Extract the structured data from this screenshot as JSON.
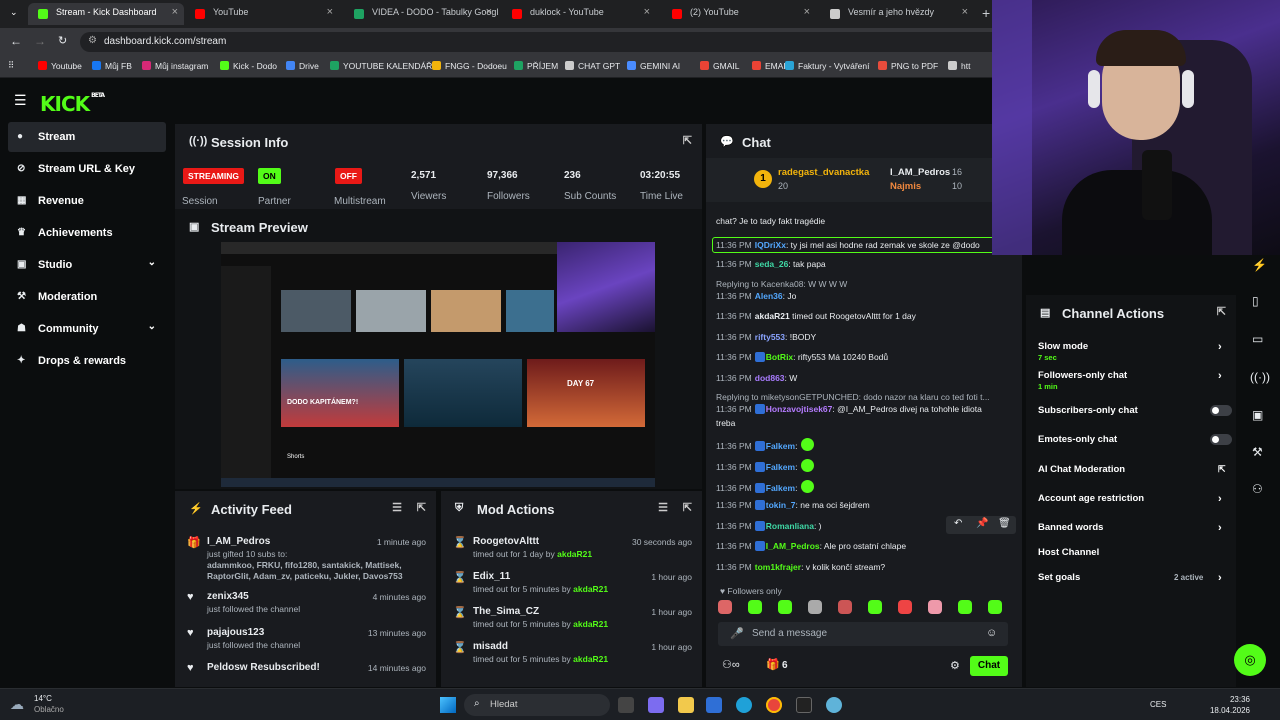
{
  "tabs": [
    {
      "title": "Stream - Kick Dashboard",
      "color": "#53fc18",
      "active": true
    },
    {
      "title": "YouTube",
      "color": "#ff0000"
    },
    {
      "title": "VIDEA - DODO - Tabulky Googl",
      "color": "#1ea362"
    },
    {
      "title": "duklock - YouTube",
      "color": "#ff0000"
    },
    {
      "title": "(2) YouTube",
      "color": "#ff0000"
    },
    {
      "title": "Vesmír a jeho hvězdy",
      "color": "#cccccc"
    }
  ],
  "url": "dashboard.kick.com/stream",
  "bookmarks": [
    "Youtube",
    "Můj FB",
    "Můj instagram",
    "Kick - Dodo",
    "Drive",
    "YOUTUBE KALENDÁŘ",
    "FNGG - Dodoeu",
    "PŘÍJEM",
    "CHAT GPT",
    "GEMINI AI",
    "GMAIL",
    "EMAIL",
    "Faktury - Vytváření",
    "PNG to PDF",
    "htt"
  ],
  "logo": "KICK",
  "logo_sup": "BETA",
  "nav": [
    {
      "label": "Stream",
      "icon": "●"
    },
    {
      "label": "Stream URL & Key",
      "icon": "⊘"
    },
    {
      "label": "Revenue",
      "icon": "▦"
    },
    {
      "label": "Achievements",
      "icon": "♛"
    },
    {
      "label": "Studio",
      "icon": "▣"
    },
    {
      "label": "Moderation",
      "icon": "⚒"
    },
    {
      "label": "Community",
      "icon": "☗"
    },
    {
      "label": "Drops & rewards",
      "icon": "✦"
    }
  ],
  "session": {
    "title": "Session Info",
    "status": "STREAMING",
    "status_label": "Session",
    "partner": "ON",
    "partner_label": "Partner",
    "multistream": "OFF",
    "multistream_label": "Multistream",
    "viewers": "2,571",
    "viewers_label": "Viewers",
    "followers": "97,366",
    "followers_label": "Followers",
    "subs": "236",
    "subs_label": "Sub Counts",
    "time": "03:20:55",
    "time_label": "Time Live"
  },
  "preview_title": "Stream Preview",
  "preview_text": {
    "t1": "DODO KAPITÁNEM?!",
    "t2": "DAY 67",
    "t3": "Shorts"
  },
  "activity": {
    "title": "Activity Feed",
    "items": [
      {
        "name": "I_AM_Pedros",
        "text": "just gifted 10 subs to:",
        "time": "1 minute ago",
        "list": "adammkoo, FRKU, fifo1280, santakick, Mattisek, RaptorGlit, Adam_zv, paticeku, Jukler, Davos753"
      },
      {
        "name": "zenix345",
        "text": "just followed the channel",
        "time": "4 minutes ago"
      },
      {
        "name": "pajajous123",
        "text": "just followed the channel",
        "time": "13 minutes ago"
      },
      {
        "name": "Peldosw Resubscribed!",
        "text": "",
        "time": "14 minutes ago"
      }
    ]
  },
  "mod": {
    "title": "Mod Actions",
    "items": [
      {
        "name": "RoogetovAlttt",
        "pre": "timed out for 1 day by",
        "by": "akdaR21",
        "time": "30 seconds ago"
      },
      {
        "name": "Edix_11",
        "pre": "timed out for 5 minutes by",
        "by": "akdaR21",
        "time": "1 hour ago"
      },
      {
        "name": "The_Sima_CZ",
        "pre": "timed out for 5 minutes by",
        "by": "akdaR21",
        "time": "1 hour ago"
      },
      {
        "name": "misadd",
        "pre": "timed out for 5 minutes by",
        "by": "akdaR21",
        "time": "1 hour ago"
      }
    ]
  },
  "chat": {
    "title": "Chat",
    "pinned": {
      "rank": "1",
      "u1": "radegast_dvanactka",
      "v1": "20",
      "u2": "I_AM_Pedros",
      "v2": "16",
      "u3": "Najmis",
      "v3": "10"
    },
    "messages": [
      {
        "time": "",
        "user": "",
        "color": "#e9ecef",
        "text": "chat? Je to tady fakt tragédie"
      },
      {
        "time": "11:36 PM",
        "user": "IQDriXx",
        "color": "#53a8ff",
        "text": ": ty jsi mel asi hodne rad zemak ve skole ze @dodo"
      },
      {
        "time": "11:36 PM",
        "user": "seda_26",
        "color": "#3fd9a6",
        "text": ": tak papa"
      },
      {
        "time": "",
        "user": "",
        "color": "#adb5bd",
        "text": "Replying to Kacenka08: W W W W"
      },
      {
        "time": "11:36 PM",
        "user": "Alen36",
        "color": "#53a8ff",
        "text": ": Jo"
      },
      {
        "time": "11:36 PM",
        "user": "akdaR21",
        "color": "#e9ecef",
        "text": " timed out RoogetovAlttt for 1 day"
      },
      {
        "time": "11:36 PM",
        "user": "rifty553",
        "color": "#8aa4ff",
        "text": ": !BODY"
      },
      {
        "time": "11:36 PM",
        "user": "BotRix",
        "color": "#53fc18",
        "text": ": rifty553 Má 10240 Bodů"
      },
      {
        "time": "11:36 PM",
        "user": "dod863",
        "color": "#a97cff",
        "text": ": W"
      },
      {
        "time": "",
        "user": "",
        "color": "#adb5bd",
        "text": "Replying to miketysonGETPUNCHED: dodo nazor na klaru co ted foti t..."
      },
      {
        "time": "11:36 PM",
        "user": "Honzavojtisek67",
        "color": "#b57cff",
        "text": ": @I_AM_Pedros divej na tohohle idiota"
      },
      {
        "time": "",
        "user": "",
        "color": "#e9ecef",
        "text": "treba"
      },
      {
        "time": "11:36 PM",
        "user": "Falkem",
        "color": "#53a8ff",
        "text": ":"
      },
      {
        "time": "11:36 PM",
        "user": "Falkem",
        "color": "#53a8ff",
        "text": ":"
      },
      {
        "time": "11:36 PM",
        "user": "Falkem",
        "color": "#53a8ff",
        "text": ":"
      },
      {
        "time": "11:36 PM",
        "user": "tokin_7",
        "color": "#53a8ff",
        "text": ": ne ma oci šejdrem"
      },
      {
        "time": "11:36 PM",
        "user": "Romanliana",
        "color": "#3fd9a6",
        "text": ": )"
      },
      {
        "time": "11:36 PM",
        "user": "I_AM_Pedros",
        "color": "#53fc18",
        "text": ": Ale pro ostatní chlape"
      },
      {
        "time": "11:36 PM",
        "user": "tom1kfrajer",
        "color": "#53fc18",
        "text": ": v kolik končí stream?"
      }
    ],
    "followers_only": "Followers only",
    "placeholder": "Send a message",
    "count": "6",
    "send": "Chat"
  },
  "actions": {
    "title": "Channel Actions",
    "items": [
      {
        "label": "Slow mode",
        "sub": "7 sec",
        "ctrl": "chev"
      },
      {
        "label": "Followers-only chat",
        "sub": "1 min",
        "ctrl": "chev"
      },
      {
        "label": "Subscribers-only chat",
        "sub": "",
        "ctrl": "toggle"
      },
      {
        "label": "Emotes-only chat",
        "sub": "",
        "ctrl": "toggle"
      },
      {
        "label": "AI Chat Moderation",
        "sub": "",
        "ctrl": "ext"
      },
      {
        "label": "Account age restriction",
        "sub": "",
        "ctrl": "chev"
      },
      {
        "label": "Banned words",
        "sub": "",
        "ctrl": "chev"
      },
      {
        "label": "Host Channel",
        "sub": "",
        "ctrl": ""
      },
      {
        "label": "Set goals",
        "sub": "",
        "ctrl": "chev",
        "extra": "2 active"
      }
    ]
  },
  "taskbar": {
    "temp": "14°C",
    "weather": "Oblačno",
    "search": "Hledat",
    "lang": "CES",
    "time": "23:36",
    "date": "18.04.2026"
  }
}
